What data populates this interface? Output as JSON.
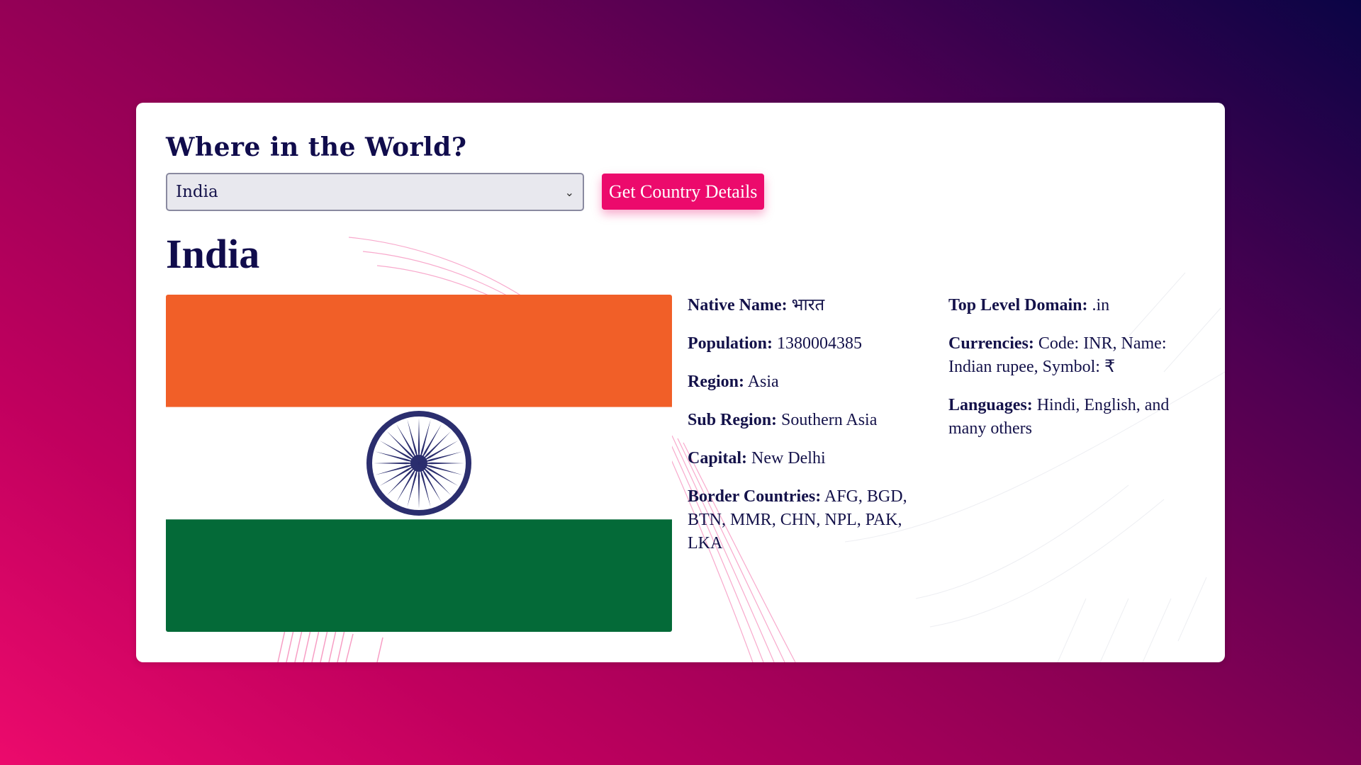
{
  "app": {
    "title": "Where in the World?"
  },
  "controls": {
    "selected_country": "India",
    "button_label": "Get Country Details"
  },
  "country": {
    "name": "India",
    "flag_colors": {
      "saffron": "#F15F28",
      "white": "#FFFFFF",
      "green": "#046A38",
      "chakra": "#2B2E6E"
    },
    "details_left": [
      {
        "label": "Native Name:",
        "value": "भारत"
      },
      {
        "label": "Population:",
        "value": "1380004385"
      },
      {
        "label": "Region:",
        "value": "Asia"
      },
      {
        "label": "Sub Region:",
        "value": "Southern Asia"
      },
      {
        "label": "Capital:",
        "value": "New Delhi"
      },
      {
        "label": "Border Countries:",
        "value": "AFG, BGD, BTN, MMR, CHN, NPL, PAK, LKA"
      }
    ],
    "details_right": [
      {
        "label": "Top Level Domain:",
        "value": ".in"
      },
      {
        "label": "Currencies:",
        "value": "Code: INR, Name: Indian rupee, Symbol: ₹"
      },
      {
        "label": "Languages:",
        "value": "Hindi, English, and many others"
      }
    ]
  },
  "theme": {
    "accent": "#ec0a6c",
    "text": "#100c4c"
  }
}
